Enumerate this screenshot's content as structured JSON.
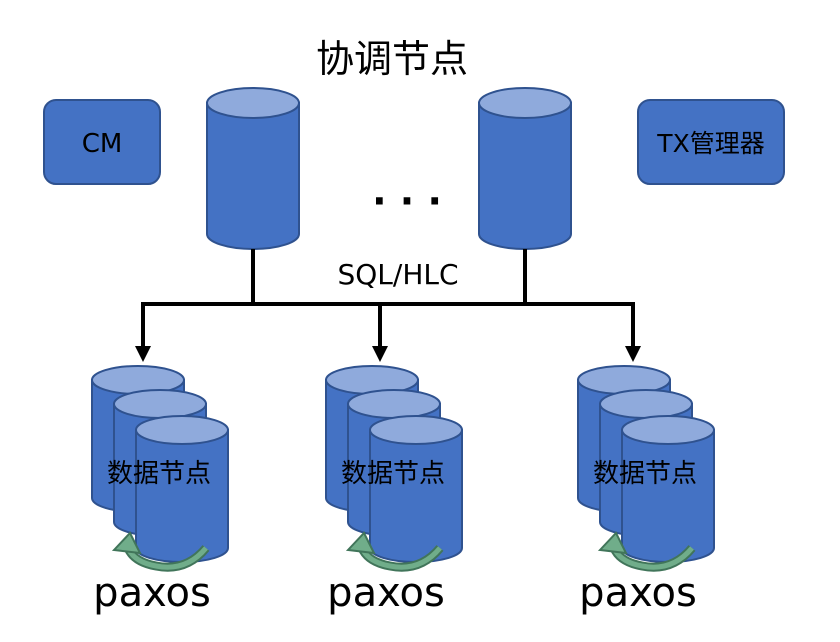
{
  "title": "协调节点",
  "left_box": {
    "label": "CM"
  },
  "right_box": {
    "label": "TX管理器"
  },
  "ellipsis": "· · ·",
  "bus_label": "SQL/HLC",
  "data_nodes": [
    {
      "label": "数据节点",
      "caption": "paxos"
    },
    {
      "label": "数据节点",
      "caption": "paxos"
    },
    {
      "label": "数据节点",
      "caption": "paxos"
    }
  ],
  "colors": {
    "node_fill": "#4472C4",
    "node_top": "#8FAADC",
    "node_stroke": "#2F528F",
    "paxos_arrow": "#70AD8A"
  }
}
